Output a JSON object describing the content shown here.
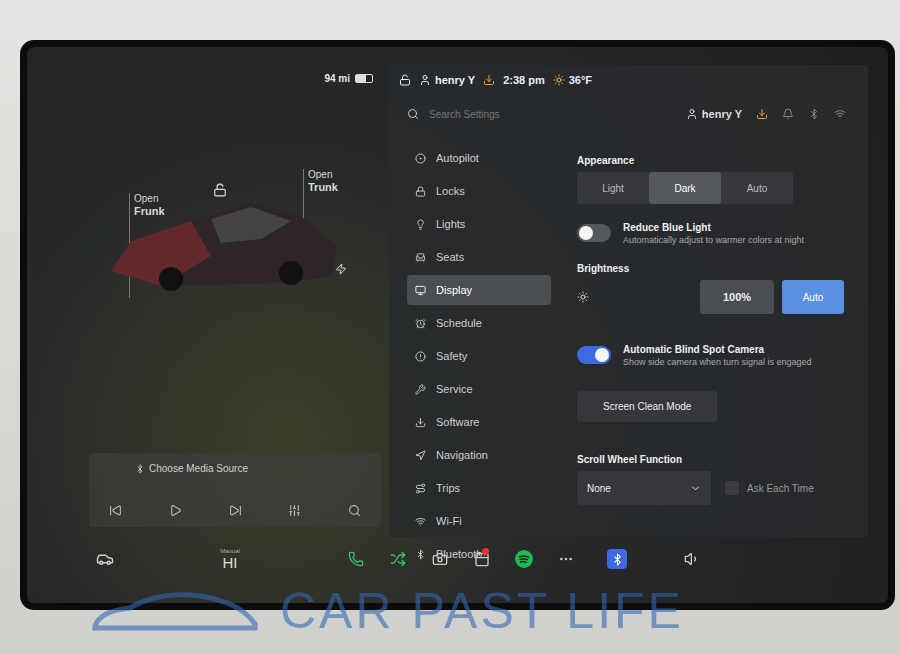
{
  "status": {
    "range": "94 mi"
  },
  "header": {
    "user": "henry Y",
    "time": "2:38 pm",
    "temperature": "36°F"
  },
  "car": {
    "frunk": {
      "action": "Open",
      "name": "Frunk"
    },
    "trunk": {
      "action": "Open",
      "name": "Trunk"
    },
    "locked": false,
    "charging": true
  },
  "media": {
    "source": "Choose Media Source"
  },
  "settings": {
    "search_placeholder": "Search Settings",
    "user": "henry Y",
    "menu": [
      {
        "label": "Autopilot",
        "selected": false
      },
      {
        "label": "Locks",
        "selected": false
      },
      {
        "label": "Lights",
        "selected": false
      },
      {
        "label": "Seats",
        "selected": false
      },
      {
        "label": "Display",
        "selected": true
      },
      {
        "label": "Schedule",
        "selected": false
      },
      {
        "label": "Safety",
        "selected": false
      },
      {
        "label": "Service",
        "selected": false
      },
      {
        "label": "Software",
        "selected": false
      },
      {
        "label": "Navigation",
        "selected": false
      },
      {
        "label": "Trips",
        "selected": false
      },
      {
        "label": "Wi-Fi",
        "selected": false
      },
      {
        "label": "Bluetooth",
        "selected": false
      }
    ]
  },
  "display": {
    "appearance": {
      "label": "Appearance",
      "options": [
        {
          "label": "Light",
          "selected": false
        },
        {
          "label": "Dark",
          "selected": true
        },
        {
          "label": "Auto",
          "selected": false
        }
      ]
    },
    "reduce_blue_light": {
      "title": "Reduce Blue Light",
      "subtitle": "Automatically adjust to warmer colors at night",
      "on": false
    },
    "brightness": {
      "label": "Brightness",
      "value": "100%",
      "auto": {
        "label": "Auto",
        "selected": true
      }
    },
    "blind_spot": {
      "title": "Automatic Blind Spot Camera",
      "subtitle": "Show side camera when turn signal is engaged",
      "on": true
    },
    "screen_clean": "Screen Clean Mode",
    "scroll_wheel": {
      "label": "Scroll Wheel Function",
      "value": "None",
      "ask": {
        "label": "Ask Each Time",
        "checked": false
      }
    }
  },
  "climate": {
    "mode": "Manual",
    "temperature": "HI"
  },
  "dock": {
    "notification": true
  },
  "watermark": "CAR PAST LIFE"
}
